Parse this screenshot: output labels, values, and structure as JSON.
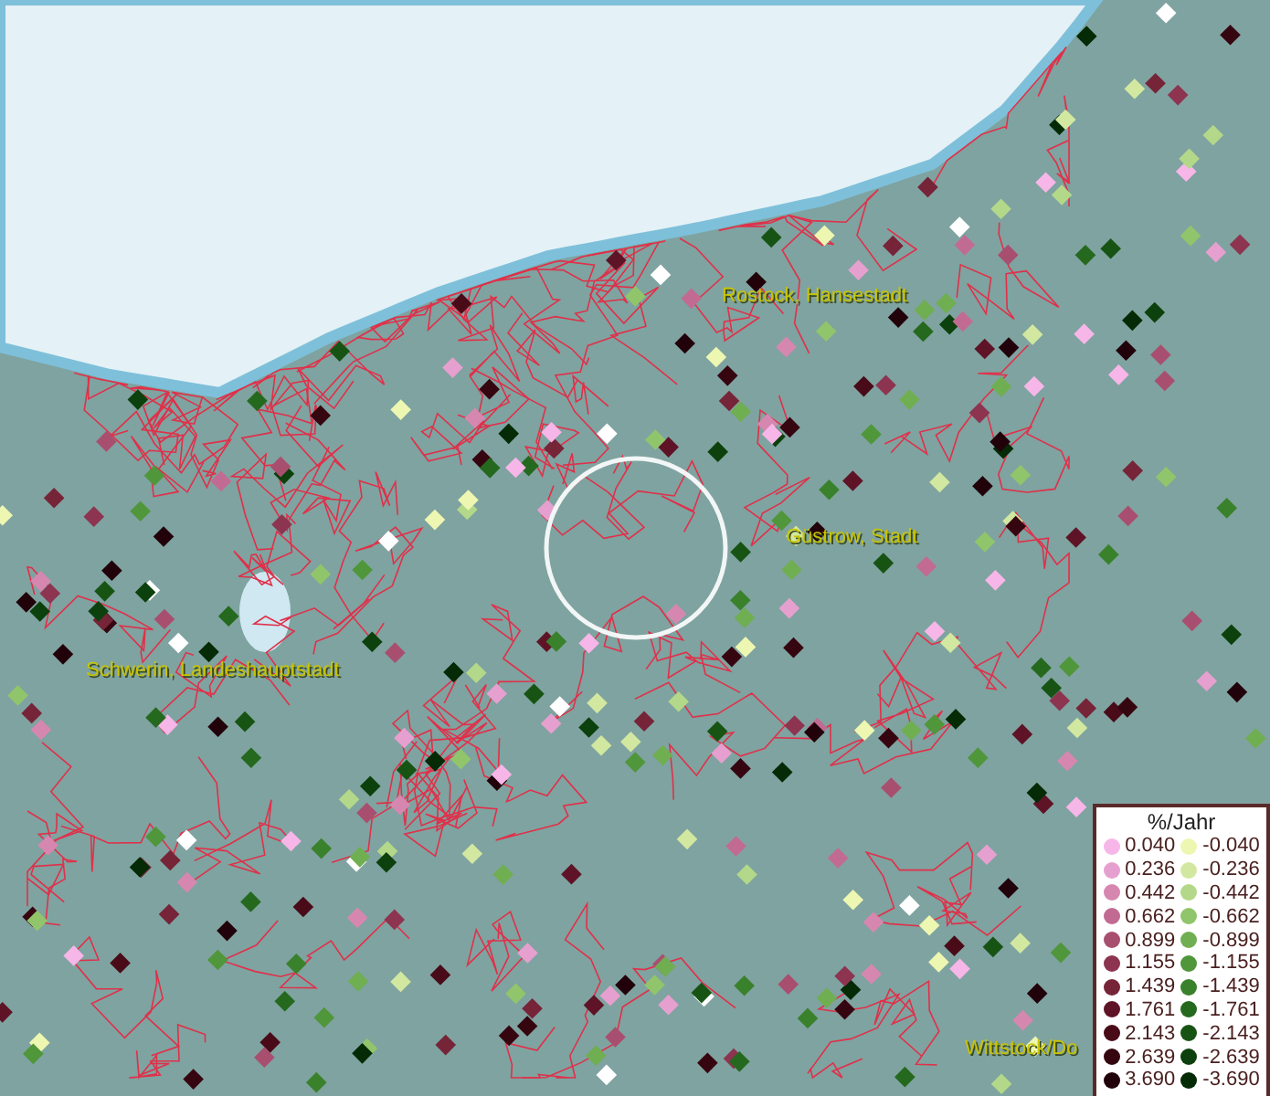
{
  "places": [
    {
      "name": "Rostock, Hansestadt"
    },
    {
      "name": "Güstrow, Stadt"
    },
    {
      "name": "Schwerin, Landeshauptstadt"
    },
    {
      "name": "Wittstock/Do"
    }
  ],
  "legend": {
    "title": "%/Jahr",
    "positive": [
      {
        "label": "0.040",
        "color": "#f7b6e8"
      },
      {
        "label": "0.236",
        "color": "#e6a0cf"
      },
      {
        "label": "0.442",
        "color": "#d687b0"
      },
      {
        "label": "0.662",
        "color": "#c26b92"
      },
      {
        "label": "0.899",
        "color": "#a84f70"
      },
      {
        "label": "1.155",
        "color": "#8d3450"
      },
      {
        "label": "1.439",
        "color": "#762438"
      },
      {
        "label": "1.761",
        "color": "#5e1426"
      },
      {
        "label": "2.143",
        "color": "#4a0b18"
      },
      {
        "label": "2.639",
        "color": "#360610"
      },
      {
        "label": "3.690",
        "color": "#22020a"
      }
    ],
    "negative": [
      {
        "label": "-0.040",
        "color": "#eef7b2"
      },
      {
        "label": "-0.236",
        "color": "#d2e8a0"
      },
      {
        "label": "-0.442",
        "color": "#b3d889"
      },
      {
        "label": "-0.662",
        "color": "#91c56b"
      },
      {
        "label": "-0.899",
        "color": "#70ae52"
      },
      {
        "label": "-1.155",
        "color": "#50963b"
      },
      {
        "label": "-1.439",
        "color": "#3a812c"
      },
      {
        "label": "-1.761",
        "color": "#25691f"
      },
      {
        "label": "-2.143",
        "color": "#175414"
      },
      {
        "label": "-2.639",
        "color": "#0c400c"
      },
      {
        "label": "-3.690",
        "color": "#042a06"
      }
    ]
  }
}
